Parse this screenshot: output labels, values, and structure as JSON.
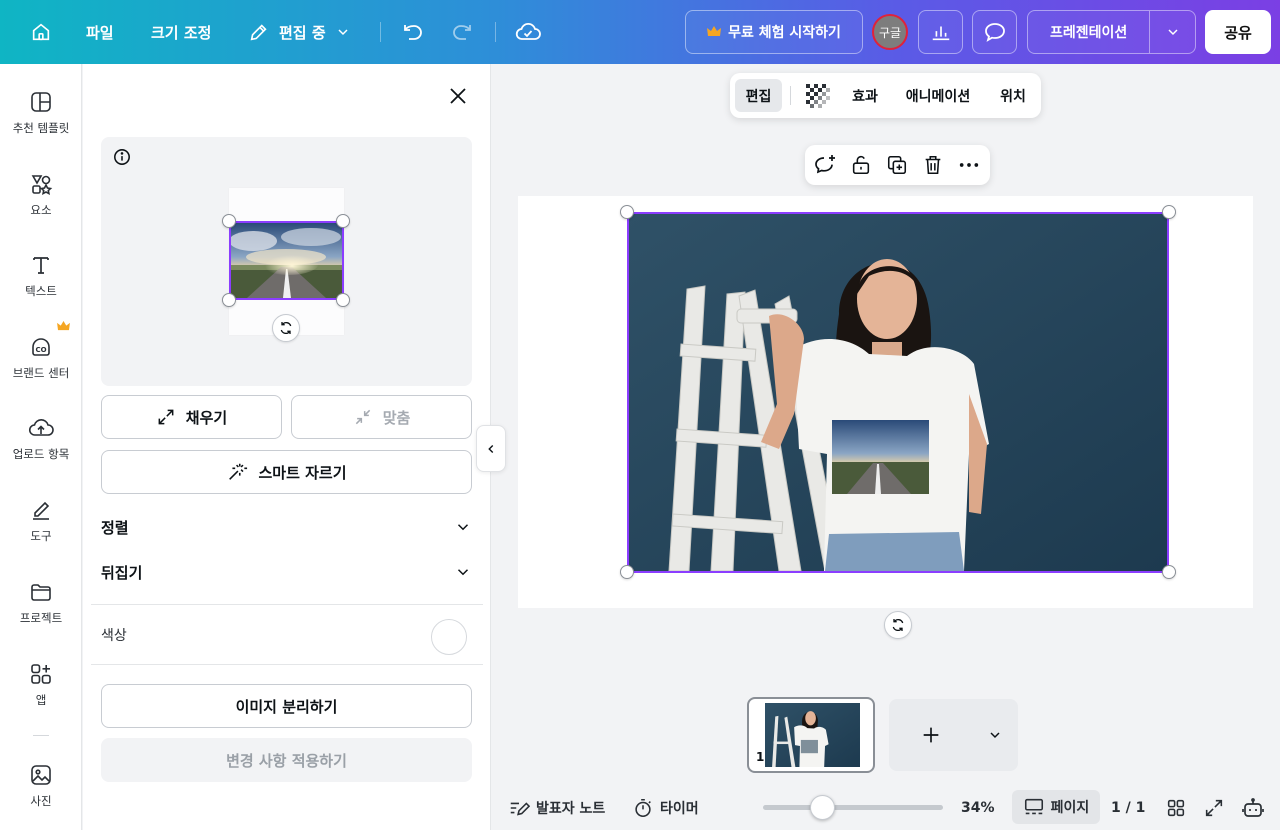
{
  "topbar": {
    "file_label": "파일",
    "resize_label": "크기 조정",
    "editing_label": "편집 중",
    "trial_label": "무료 체험 시작하기",
    "avatar_label": "구글",
    "present_label": "프레젠테이션",
    "share_label": "공유"
  },
  "sidebar": {
    "items": [
      {
        "label": "추천 템플릿",
        "icon": "template-icon"
      },
      {
        "label": "요소",
        "icon": "elements-icon"
      },
      {
        "label": "텍스트",
        "icon": "text-icon"
      },
      {
        "label": "브랜드 센터",
        "icon": "brand-icon"
      },
      {
        "label": "업로드 항목",
        "icon": "upload-cloud-icon"
      },
      {
        "label": "도구",
        "icon": "draw-tool-icon"
      },
      {
        "label": "프로젝트",
        "icon": "folder-icon"
      },
      {
        "label": "앱",
        "icon": "apps-icon"
      },
      {
        "label": "사진",
        "icon": "photo-icon"
      }
    ]
  },
  "panel": {
    "fill_label": "채우기",
    "fit_label": "맞춤",
    "smart_crop_label": "스마트 자르기",
    "align_label": "정렬",
    "flip_label": "뒤집기",
    "color_label": "색상",
    "separate_label": "이미지 분리하기",
    "apply_label": "변경 사항 적용하기"
  },
  "context_toolbar": {
    "edit_label": "편집",
    "effects_label": "효과",
    "animate_label": "애니메이션",
    "position_label": "위치"
  },
  "thumbnail": {
    "page_number": "1"
  },
  "bottom_bar": {
    "notes_label": "발표자 노트",
    "timer_label": "타이머",
    "zoom_value": "34%",
    "zoom_fraction": 0.34,
    "pages_label": "페이지",
    "page_counter": "1 / 1"
  },
  "colors": {
    "accent": "#8b3dff",
    "gradient_start": "#0fb5c4",
    "gradient_end": "#7b3fe4",
    "crown": "#f5a623"
  }
}
